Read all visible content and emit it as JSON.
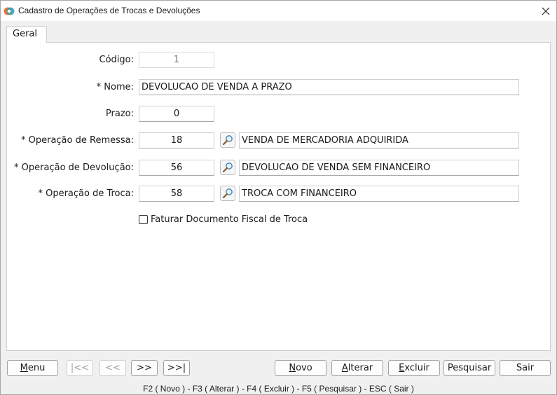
{
  "window": {
    "title": "Cadastro de Operações de Trocas e Devoluções"
  },
  "tabs": [
    {
      "label": "Geral"
    }
  ],
  "form": {
    "codigo": {
      "label": "Código:",
      "value": "1"
    },
    "nome": {
      "label": "* Nome:",
      "value": "DEVOLUCAO DE VENDA A PRAZO"
    },
    "prazo": {
      "label": "Prazo:",
      "value": "0"
    },
    "remessa": {
      "label": "* Operação de Remessa:",
      "code": "18",
      "description": "VENDA DE MERCADORIA ADQUIRIDA"
    },
    "devolucao": {
      "label": "* Operação de Devolução:",
      "code": "56",
      "description": "DEVOLUCAO DE VENDA SEM FINANCEIRO"
    },
    "troca": {
      "label": "* Operação de Troca:",
      "code": "58",
      "description": "TROCA COM FINANCEIRO"
    },
    "faturar": {
      "label": "Faturar Documento Fiscal de Troca",
      "checked": false
    }
  },
  "buttons": {
    "menu": {
      "first": "M",
      "rest": "enu"
    },
    "first": "|<<",
    "prev": "<<",
    "next": ">>",
    "last": ">>|",
    "novo": {
      "first": "N",
      "rest": "ovo"
    },
    "alterar": {
      "first": "A",
      "rest": "lterar"
    },
    "excluir": {
      "first": "E",
      "rest": "xcluir"
    },
    "pesquisar": "Pesquisar",
    "sair": "Sair"
  },
  "statusbar": "F2 ( Novo )  -  F3 ( Alterar )  -  F4 ( Excluir )  -  F5 ( Pesquisar )  -  ESC ( Sair )",
  "colors": {
    "accent_orange": "#e8762c",
    "accent_teal": "#2a9db5"
  }
}
